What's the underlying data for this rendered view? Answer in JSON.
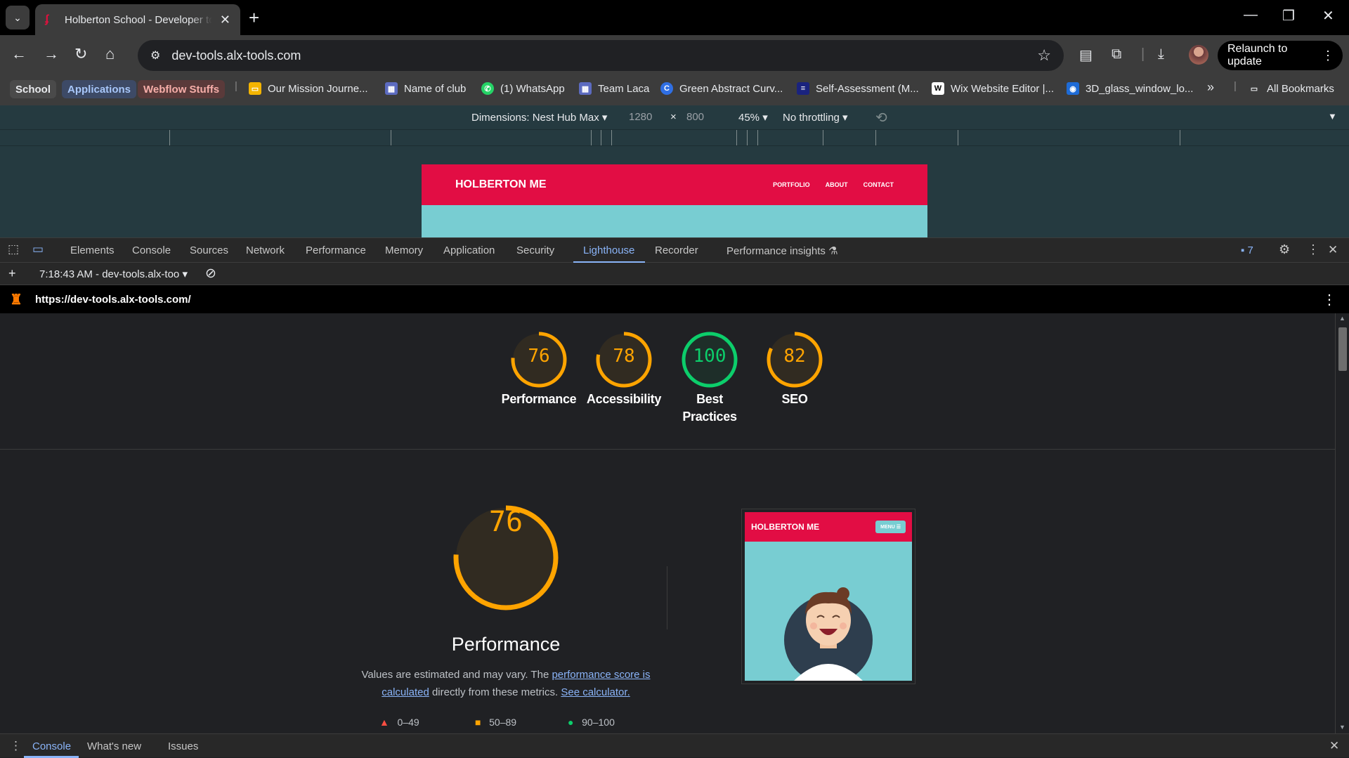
{
  "browser": {
    "tab_title": "Holberton School - Developer tools",
    "url": "dev-tools.alx-tools.com",
    "relaunch_label": "Relaunch to update"
  },
  "bookmarks": {
    "chips": [
      "School",
      "Applications",
      "Webflow Stuffs"
    ],
    "items": [
      {
        "label": "Our Mission Journe...",
        "icon": "slides-icon",
        "color": "#f4b400"
      },
      {
        "label": "Name of club",
        "icon": "forms-icon",
        "color": "#5c6bc0"
      },
      {
        "label": "(1) WhatsApp",
        "icon": "whatsapp-icon",
        "color": "#25d366"
      },
      {
        "label": "Team Laca",
        "icon": "forms-icon",
        "color": "#5c6bc0"
      },
      {
        "label": "Green Abstract Curv...",
        "icon": "canva-icon",
        "color": "#2f6fe4"
      },
      {
        "label": "Self-Assessment (M...",
        "icon": "doc-icon",
        "color": "#1a237e"
      },
      {
        "label": "Wix Website Editor |...",
        "icon": "wix-icon",
        "color": "#ffffff"
      },
      {
        "label": "3D_glass_window_lo...",
        "icon": "image-icon",
        "color": "#1e6bd6"
      }
    ],
    "all_bookmarks": "All Bookmarks"
  },
  "device_toolbar": {
    "dimensions": "Dimensions: Nest Hub Max",
    "width": "1280",
    "height": "800",
    "zoom": "45%",
    "throttling": "No throttling"
  },
  "preview_site": {
    "brand": "HOLBERTON ME",
    "nav": [
      "PORTFOLIO",
      "ABOUT",
      "CONTACT"
    ]
  },
  "devtools": {
    "tabs": [
      "Elements",
      "Console",
      "Sources",
      "Network",
      "Performance",
      "Memory",
      "Application",
      "Security",
      "Lighthouse",
      "Recorder",
      "Performance insights"
    ],
    "active_tab": "Lighthouse",
    "issues_count": "7",
    "report_selector": "7:18:43 AM - dev-tools.alx-too",
    "report_url": "https://dev-tools.alx-tools.com/"
  },
  "lighthouse": {
    "scores": [
      {
        "label": "Performance",
        "value": 76,
        "color": "#ffa400"
      },
      {
        "label": "Accessibility",
        "value": 78,
        "color": "#ffa400"
      },
      {
        "label": "Best Practices",
        "value": 100,
        "color": "#0cce6b"
      },
      {
        "label": "SEO",
        "value": 82,
        "color": "#ffa400"
      }
    ],
    "main_score": "76",
    "main_title": "Performance",
    "desc_prefix": "Values are estimated and may vary. The ",
    "desc_link1": "performance score is calculated",
    "desc_mid": " directly from these metrics. ",
    "desc_link2": "See calculator.",
    "legend": [
      "0–49",
      "50–89",
      "90–100"
    ],
    "screenshot_brand": "HOLBERTON ME",
    "screenshot_menu": "MENU ☰"
  },
  "drawer": {
    "tabs": [
      "Console",
      "What's new",
      "Issues"
    ]
  }
}
